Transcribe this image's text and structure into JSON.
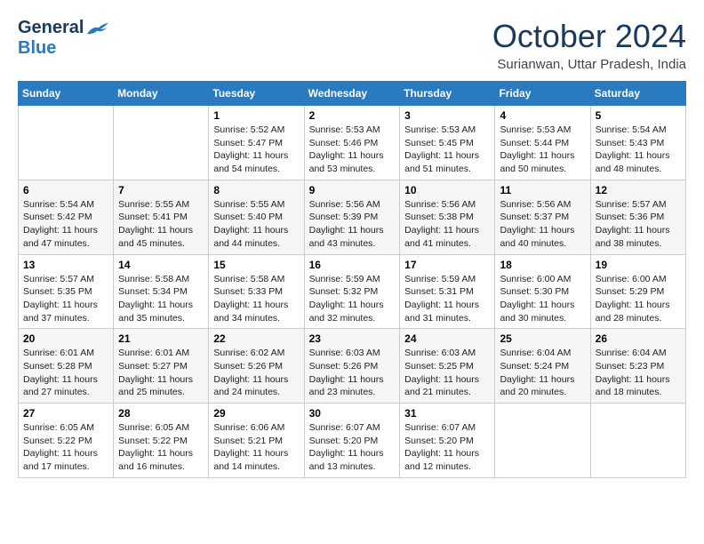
{
  "header": {
    "logo_general": "General",
    "logo_blue": "Blue",
    "month_title": "October 2024",
    "location": "Surianwan, Uttar Pradesh, India"
  },
  "days_of_week": [
    "Sunday",
    "Monday",
    "Tuesday",
    "Wednesday",
    "Thursday",
    "Friday",
    "Saturday"
  ],
  "weeks": [
    [
      {
        "day": "",
        "sunrise": "",
        "sunset": "",
        "daylight": ""
      },
      {
        "day": "",
        "sunrise": "",
        "sunset": "",
        "daylight": ""
      },
      {
        "day": "1",
        "sunrise": "Sunrise: 5:52 AM",
        "sunset": "Sunset: 5:47 PM",
        "daylight": "Daylight: 11 hours and 54 minutes."
      },
      {
        "day": "2",
        "sunrise": "Sunrise: 5:53 AM",
        "sunset": "Sunset: 5:46 PM",
        "daylight": "Daylight: 11 hours and 53 minutes."
      },
      {
        "day": "3",
        "sunrise": "Sunrise: 5:53 AM",
        "sunset": "Sunset: 5:45 PM",
        "daylight": "Daylight: 11 hours and 51 minutes."
      },
      {
        "day": "4",
        "sunrise": "Sunrise: 5:53 AM",
        "sunset": "Sunset: 5:44 PM",
        "daylight": "Daylight: 11 hours and 50 minutes."
      },
      {
        "day": "5",
        "sunrise": "Sunrise: 5:54 AM",
        "sunset": "Sunset: 5:43 PM",
        "daylight": "Daylight: 11 hours and 48 minutes."
      }
    ],
    [
      {
        "day": "6",
        "sunrise": "Sunrise: 5:54 AM",
        "sunset": "Sunset: 5:42 PM",
        "daylight": "Daylight: 11 hours and 47 minutes."
      },
      {
        "day": "7",
        "sunrise": "Sunrise: 5:55 AM",
        "sunset": "Sunset: 5:41 PM",
        "daylight": "Daylight: 11 hours and 45 minutes."
      },
      {
        "day": "8",
        "sunrise": "Sunrise: 5:55 AM",
        "sunset": "Sunset: 5:40 PM",
        "daylight": "Daylight: 11 hours and 44 minutes."
      },
      {
        "day": "9",
        "sunrise": "Sunrise: 5:56 AM",
        "sunset": "Sunset: 5:39 PM",
        "daylight": "Daylight: 11 hours and 43 minutes."
      },
      {
        "day": "10",
        "sunrise": "Sunrise: 5:56 AM",
        "sunset": "Sunset: 5:38 PM",
        "daylight": "Daylight: 11 hours and 41 minutes."
      },
      {
        "day": "11",
        "sunrise": "Sunrise: 5:56 AM",
        "sunset": "Sunset: 5:37 PM",
        "daylight": "Daylight: 11 hours and 40 minutes."
      },
      {
        "day": "12",
        "sunrise": "Sunrise: 5:57 AM",
        "sunset": "Sunset: 5:36 PM",
        "daylight": "Daylight: 11 hours and 38 minutes."
      }
    ],
    [
      {
        "day": "13",
        "sunrise": "Sunrise: 5:57 AM",
        "sunset": "Sunset: 5:35 PM",
        "daylight": "Daylight: 11 hours and 37 minutes."
      },
      {
        "day": "14",
        "sunrise": "Sunrise: 5:58 AM",
        "sunset": "Sunset: 5:34 PM",
        "daylight": "Daylight: 11 hours and 35 minutes."
      },
      {
        "day": "15",
        "sunrise": "Sunrise: 5:58 AM",
        "sunset": "Sunset: 5:33 PM",
        "daylight": "Daylight: 11 hours and 34 minutes."
      },
      {
        "day": "16",
        "sunrise": "Sunrise: 5:59 AM",
        "sunset": "Sunset: 5:32 PM",
        "daylight": "Daylight: 11 hours and 32 minutes."
      },
      {
        "day": "17",
        "sunrise": "Sunrise: 5:59 AM",
        "sunset": "Sunset: 5:31 PM",
        "daylight": "Daylight: 11 hours and 31 minutes."
      },
      {
        "day": "18",
        "sunrise": "Sunrise: 6:00 AM",
        "sunset": "Sunset: 5:30 PM",
        "daylight": "Daylight: 11 hours and 30 minutes."
      },
      {
        "day": "19",
        "sunrise": "Sunrise: 6:00 AM",
        "sunset": "Sunset: 5:29 PM",
        "daylight": "Daylight: 11 hours and 28 minutes."
      }
    ],
    [
      {
        "day": "20",
        "sunrise": "Sunrise: 6:01 AM",
        "sunset": "Sunset: 5:28 PM",
        "daylight": "Daylight: 11 hours and 27 minutes."
      },
      {
        "day": "21",
        "sunrise": "Sunrise: 6:01 AM",
        "sunset": "Sunset: 5:27 PM",
        "daylight": "Daylight: 11 hours and 25 minutes."
      },
      {
        "day": "22",
        "sunrise": "Sunrise: 6:02 AM",
        "sunset": "Sunset: 5:26 PM",
        "daylight": "Daylight: 11 hours and 24 minutes."
      },
      {
        "day": "23",
        "sunrise": "Sunrise: 6:03 AM",
        "sunset": "Sunset: 5:26 PM",
        "daylight": "Daylight: 11 hours and 23 minutes."
      },
      {
        "day": "24",
        "sunrise": "Sunrise: 6:03 AM",
        "sunset": "Sunset: 5:25 PM",
        "daylight": "Daylight: 11 hours and 21 minutes."
      },
      {
        "day": "25",
        "sunrise": "Sunrise: 6:04 AM",
        "sunset": "Sunset: 5:24 PM",
        "daylight": "Daylight: 11 hours and 20 minutes."
      },
      {
        "day": "26",
        "sunrise": "Sunrise: 6:04 AM",
        "sunset": "Sunset: 5:23 PM",
        "daylight": "Daylight: 11 hours and 18 minutes."
      }
    ],
    [
      {
        "day": "27",
        "sunrise": "Sunrise: 6:05 AM",
        "sunset": "Sunset: 5:22 PM",
        "daylight": "Daylight: 11 hours and 17 minutes."
      },
      {
        "day": "28",
        "sunrise": "Sunrise: 6:05 AM",
        "sunset": "Sunset: 5:22 PM",
        "daylight": "Daylight: 11 hours and 16 minutes."
      },
      {
        "day": "29",
        "sunrise": "Sunrise: 6:06 AM",
        "sunset": "Sunset: 5:21 PM",
        "daylight": "Daylight: 11 hours and 14 minutes."
      },
      {
        "day": "30",
        "sunrise": "Sunrise: 6:07 AM",
        "sunset": "Sunset: 5:20 PM",
        "daylight": "Daylight: 11 hours and 13 minutes."
      },
      {
        "day": "31",
        "sunrise": "Sunrise: 6:07 AM",
        "sunset": "Sunset: 5:20 PM",
        "daylight": "Daylight: 11 hours and 12 minutes."
      },
      {
        "day": "",
        "sunrise": "",
        "sunset": "",
        "daylight": ""
      },
      {
        "day": "",
        "sunrise": "",
        "sunset": "",
        "daylight": ""
      }
    ]
  ]
}
